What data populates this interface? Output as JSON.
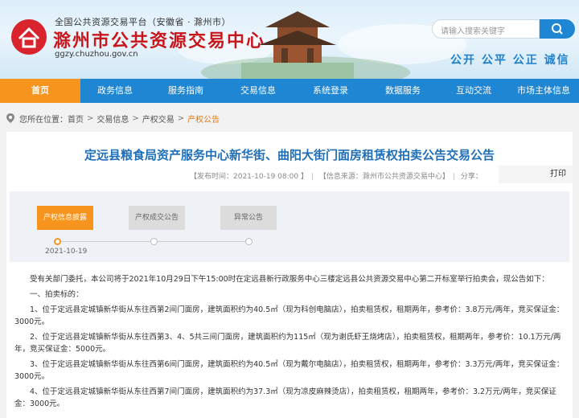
{
  "header": {
    "subtitle": "全国公共资源交易平台（安徽省 · 滁州市）",
    "title": "滁州市公共资源交易中心",
    "url": "ggzy.chuzhou.gov.cn",
    "search_placeholder": "请输入搜索关键字",
    "slogans": [
      "公开",
      "公平",
      "公正",
      "诚信"
    ]
  },
  "nav": {
    "items": [
      "首页",
      "政务信息",
      "服务指南",
      "交易信息",
      "系统登录",
      "数据服务",
      "互动交流",
      "市场主体信息"
    ]
  },
  "breadcrumb": {
    "prefix": "您所在位置：",
    "items": [
      "首页",
      "交易信息",
      "产权交易",
      "产权公告"
    ]
  },
  "article": {
    "title": "定远县粮食局资产服务中心新华街、曲阳大街门面房租赁权拍卖公告交易公告",
    "publish": "【发布时间：2021-10-19 08:00 】",
    "source": "【信息来源：滁州市公共资源交易中心】",
    "share": "分享：",
    "print": "打印",
    "steps": [
      "产权信息披露",
      "产权成交公告",
      "异常公告"
    ],
    "date": "2021-10-19",
    "paragraphs": [
      "受有关部门委托，本公司将于2021年10月29日下午15:00时在定远县新行政服务中心三楼定远县公共资源交易中心第二开标室举行拍卖会，现公告如下：",
      "一、拍卖标的：",
      "1、位于定远县定城镇新华街从东往西第2间门面房，建筑面积约为40.5㎡（现为科创电脑店），拍卖租赁权，租期两年，参考价：3.8万元/两年，竞买保证金：3000元。",
      "2、位于定远县定城镇新华街从东往西第3、4、5共三间门面房，建筑面积约为115㎡（现为谢氏虾王烧烤店），拍卖租赁权，租期两年，参考价：10.1万元/两年，竞买保证金：5000元。",
      "3、位于定远县定城镇新华街从东往西第6间门面房，建筑面积约为40.5㎡（现为戴尔电脑店），拍卖租赁权，租期两年，参考价：3.3万元/两年，竞买保证金：3000元。",
      "4、位于定远县定城镇新华街从东往西第7间门面房，建筑面积约为37.3㎡（现为凉皮麻辣烫店），拍卖租赁权，租期两年，参考价：3.2万元/两年，竞买保证金：3000元。"
    ]
  },
  "colors": {
    "nav_blue": "#1f86d3",
    "accent_orange": "#f7941d",
    "brand_red": "#c8161d",
    "title_blue": "#1f6fb8"
  },
  "icons": {
    "logo": "red-house-logo-icon",
    "search": "search-icon",
    "location": "location-pin-icon"
  }
}
